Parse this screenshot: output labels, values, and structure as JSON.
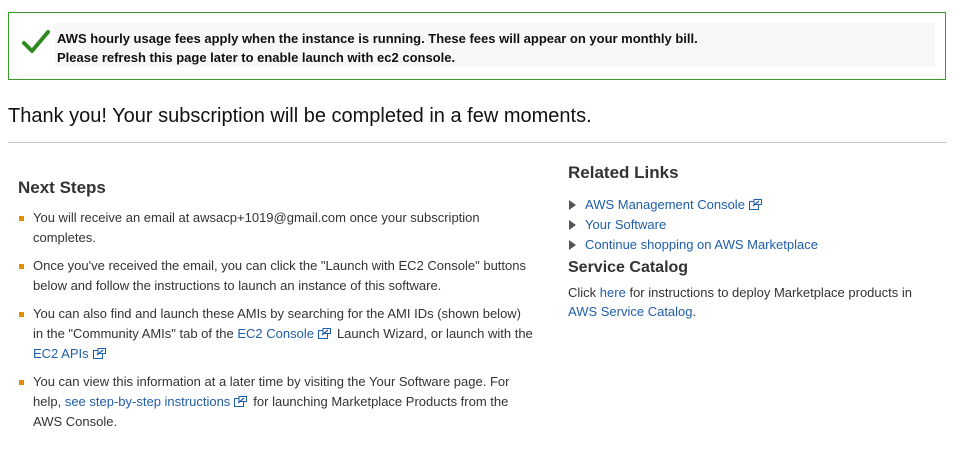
{
  "notice": {
    "line1": "AWS hourly usage fees apply when the instance is running. These fees will appear on your monthly bill.",
    "line2": "Please refresh this page later to enable launch with ec2 console."
  },
  "thanks": "Thank you! Your subscription will be completed in a few moments.",
  "next_steps": {
    "title": "Next Steps",
    "step1": "You will receive an email at awsacp+1019@gmail.com once your subscription completes.",
    "step2": "Once you've received the email, you can click the \"Launch with EC2 Console\" buttons below and follow the instructions to launch an instance of this software.",
    "step3": {
      "pre": "You can also find and launch these AMIs by searching for the AMI IDs (shown below) in the \"Community AMIs\" tab of the",
      "link1": "EC2 Console",
      "mid": "Launch Wizard, or launch with the",
      "link2": "EC2 APIs"
    },
    "step4": {
      "pre": "You can view this information at a later time by visiting the Your Software page. For help,",
      "link": "see step-by-step instructions",
      "post": "for launching Marketplace Products from the AWS Console."
    }
  },
  "related": {
    "title": "Related Links",
    "links": [
      "AWS Management Console",
      "Your Software",
      "Continue shopping on AWS Marketplace"
    ]
  },
  "catalog": {
    "title": "Service Catalog",
    "pre": "Click",
    "link1": "here",
    "mid": "for instructions to deploy Marketplace products in",
    "link2": "AWS Service Catalog",
    "post": "."
  },
  "colors": {
    "notice_border": "#3c9a2c",
    "check": "#2f8a1f",
    "link": "#1f5ea8",
    "bullet": "#e68a00"
  },
  "icons": {
    "notice": "checkmark-icon",
    "external": "external-link-icon",
    "related_bullet": "triangle-right-icon",
    "step_bullet": "square-bullet-icon"
  }
}
